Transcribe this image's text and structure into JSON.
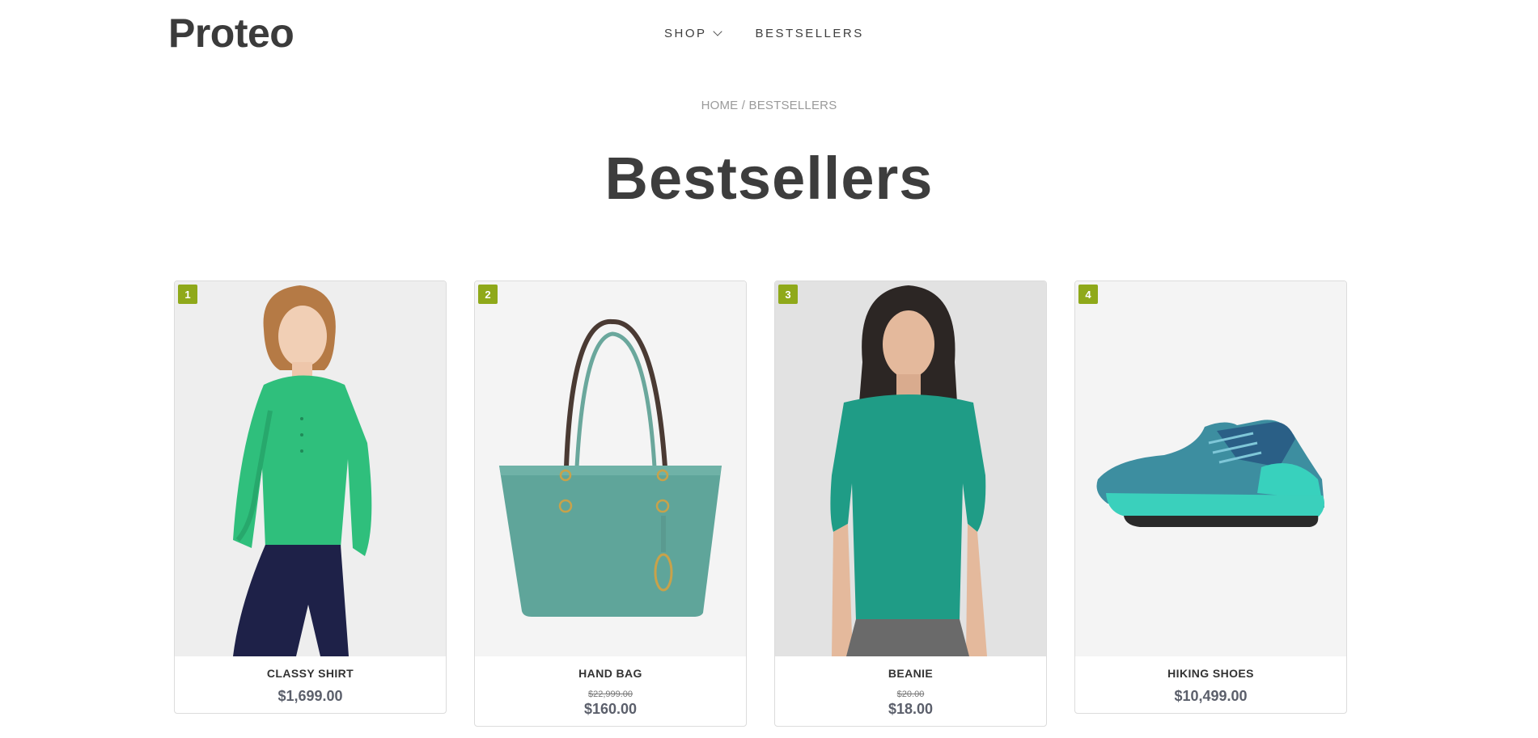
{
  "header": {
    "logo": "Proteo",
    "nav": [
      {
        "label": "SHOP",
        "has_dropdown": true
      },
      {
        "label": "BESTSELLERS",
        "has_dropdown": false
      }
    ]
  },
  "breadcrumb": {
    "home": "HOME",
    "separator": " / ",
    "current": "BESTSELLERS"
  },
  "page_title": "Bestsellers",
  "products": [
    {
      "rank": "1",
      "name": "CLASSY SHIRT",
      "old_price": "",
      "price": "$1,699.00",
      "image": "woman-green-blouse"
    },
    {
      "rank": "2",
      "name": "HAND BAG",
      "old_price": "$22,999.00",
      "price": "$160.00",
      "image": "teal-tote-bag"
    },
    {
      "rank": "3",
      "name": "BEANIE",
      "old_price": "$20.00",
      "price": "$18.00",
      "image": "woman-teal-top"
    },
    {
      "rank": "4",
      "name": "HIKING SHOES",
      "old_price": "",
      "price": "$10,499.00",
      "image": "teal-hiking-shoe"
    }
  ],
  "colors": {
    "rank_badge": "#8fa91a",
    "text_dark": "#3d3d3d",
    "breadcrumb": "#9a9a9a",
    "price": "#5b5f6b"
  }
}
